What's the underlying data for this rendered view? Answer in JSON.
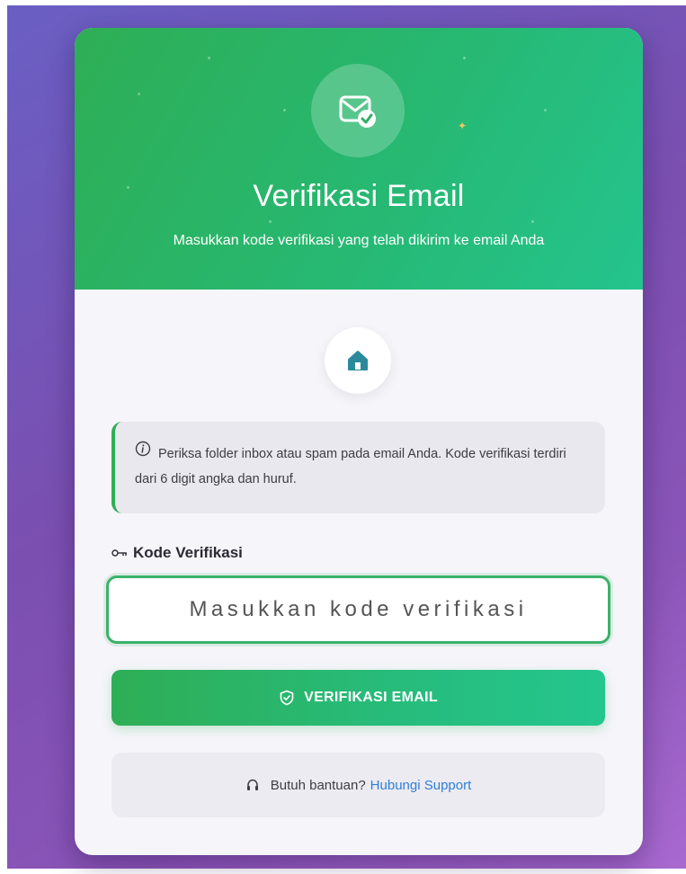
{
  "header": {
    "title": "Verifikasi Email",
    "subtitle": "Masukkan kode verifikasi yang telah dikirim ke email Anda",
    "icon": "email-verified-icon"
  },
  "home": {
    "icon": "home-icon"
  },
  "info": {
    "icon": "info-icon",
    "text": "Periksa folder inbox atau spam pada email Anda. Kode verifikasi terdiri dari 6 digit angka dan huruf."
  },
  "code_field": {
    "icon": "key-icon",
    "label": "Kode Verifikasi",
    "placeholder": "Masukkan kode verifikasi",
    "value": ""
  },
  "verify_button": {
    "icon": "shield-check-icon",
    "label": "VERIFIKASI EMAIL"
  },
  "help": {
    "icon": "headset-icon",
    "text": "Butuh bantuan?",
    "link": "Hubungi Support"
  },
  "colors": {
    "accent": "#2eae55",
    "accent_end": "#24c68f",
    "link": "#2f7fd8",
    "background": "#7a4fb0"
  }
}
